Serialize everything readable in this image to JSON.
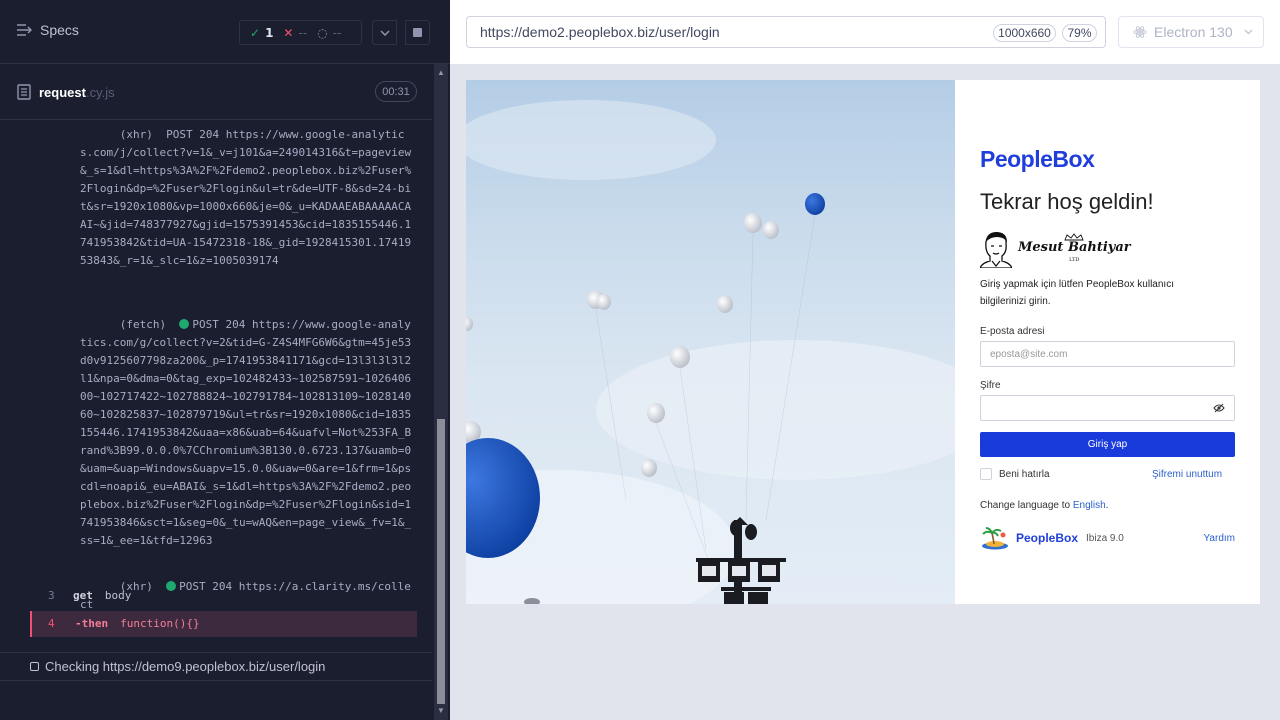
{
  "runner": {
    "specs_label": "Specs",
    "passed_count": "1",
    "failed_count": "--",
    "pending_count": "--",
    "spec_file": {
      "name": "request",
      "ext": ".cy.js",
      "duration": "00:31"
    },
    "log": {
      "entry_top": "(xhr)  POST 204 https://www.google-analytics.com/j/collect?v=1&_v=j101&a=249014316&t=pageview&_s=1&dl=https%3A%2F%2Fdemo2.peoplebox.biz%2Fuser%2Flogin&dp=%2Fuser%2Flogin&ul=tr&de=UTF-8&sd=24-bit&sr=1920x1080&vp=1000x660&je=0&_u=KADAAEABAAAAACAAI~&jid=748377927&gjid=1575391453&cid=1835155446.1741953842&tid=UA-15472318-18&_gid=1928415301.1741953843&_r=1&_slc=1&z=1005039174",
      "entry_fetch_type": "(fetch)",
      "entry_fetch_text": "POST 204 https://www.google-analytics.com/g/collect?v=2&tid=G-Z4S4MFG6W6&gtm=45je53d0v9125607798za200&_p=1741953841171&gcd=13l3l3l3l2l1&npa=0&dma=0&tag_exp=102482433~102587591~102640600~102717422~102788824~102791784~102813109~102814060~102825837~102879719&ul=tr&sr=1920x1080&cid=1835155446.1741953842&uaa=x86&uab=64&uafvl=Not%253FA_Brand%3B99.0.0.0%7CChromium%3B130.0.6723.137&uamb=0&uam=&uap=Windows&uapv=15.0.0&uaw=0&are=1&frm=1&pscdl=noapi&_eu=ABAI&_s=1&dl=https%3A%2F%2Fdemo2.peoplebox.biz%2Fuser%2Flogin&dp=%2Fuser%2Flogin&sid=1741953846&sct=1&seg=0&_tu=wAQ&en=page_view&_fv=1&_ss=1&_ee=1&tfd=12963",
      "entry_xhr_type": "(xhr)",
      "entry_xhr_text": "POST 204 https://a.clarity.ms/collect",
      "cmd3": {
        "num": "3",
        "name": "get",
        "msg": "body"
      },
      "cmd4": {
        "num": "4",
        "name": "-then",
        "msg": "function(){}"
      }
    },
    "checking_text": "Checking https://demo9.peoplebox.biz/user/login"
  },
  "browser_bar": {
    "url": "https://demo2.peoplebox.biz/user/login",
    "viewport": "1000x660",
    "zoom": "79%",
    "browser_name": "Electron 130"
  },
  "login": {
    "logo_text": "PeopleBox",
    "welcome": "Tekrar hoş geldin!",
    "brand_name": "Mesut Bahtiyar",
    "brand_sub": "LTD",
    "intro": "Giriş yapmak için lütfen PeopleBox kullanıcı bilgilerinizi girin.",
    "email_label": "E-posta adresi",
    "email_placeholder": "eposta@site.com",
    "password_label": "Şifre",
    "submit_label": "Giriş yap",
    "remember_label": "Beni hatırla",
    "forgot_label": "Şifremi unuttum",
    "lang_prefix": "Change language to",
    "lang_link": "English",
    "footer_logo": "PeopleBox",
    "footer_version": "Ibiza 9.0",
    "help_label": "Yardım"
  },
  "colors": {
    "accent": "#1a3bdc",
    "pass": "#1fa971",
    "fail": "#f05076"
  }
}
